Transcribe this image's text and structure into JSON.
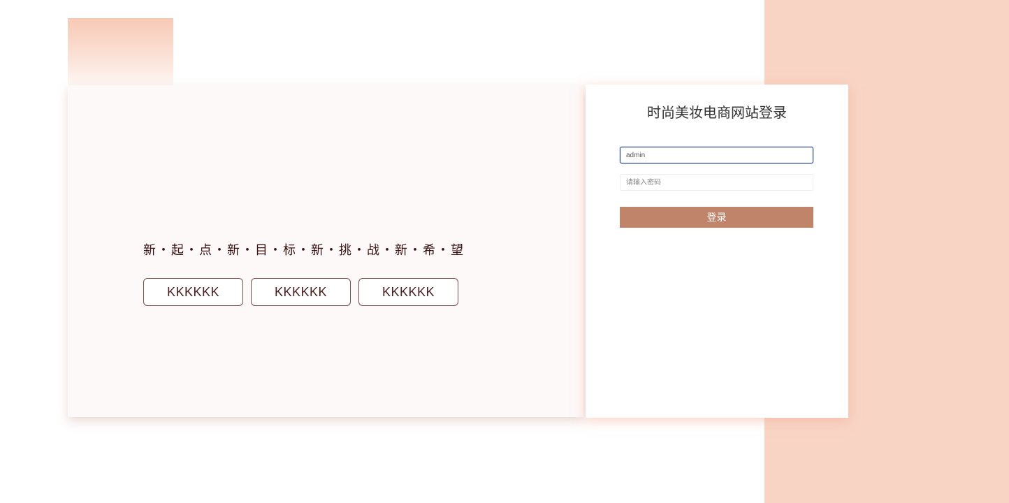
{
  "login": {
    "title": "时尚美妆电商网站登录",
    "username": {
      "value": "admin",
      "placeholder": ""
    },
    "password": {
      "value": "",
      "placeholder": "请输入密码"
    },
    "submit_label": "登录"
  },
  "hero": {
    "slogan": "新・起・点・新・目・标・新・挑・战・新・希・望",
    "tags": [
      {
        "label": "KKKKKK"
      },
      {
        "label": "KKKKKK"
      },
      {
        "label": "KKKKKK"
      }
    ]
  },
  "colors": {
    "accent_peach": "#f8d4c4",
    "button": "#c0846b",
    "focus_border": "#1a3a8a",
    "slogan_text": "#3a1212"
  }
}
